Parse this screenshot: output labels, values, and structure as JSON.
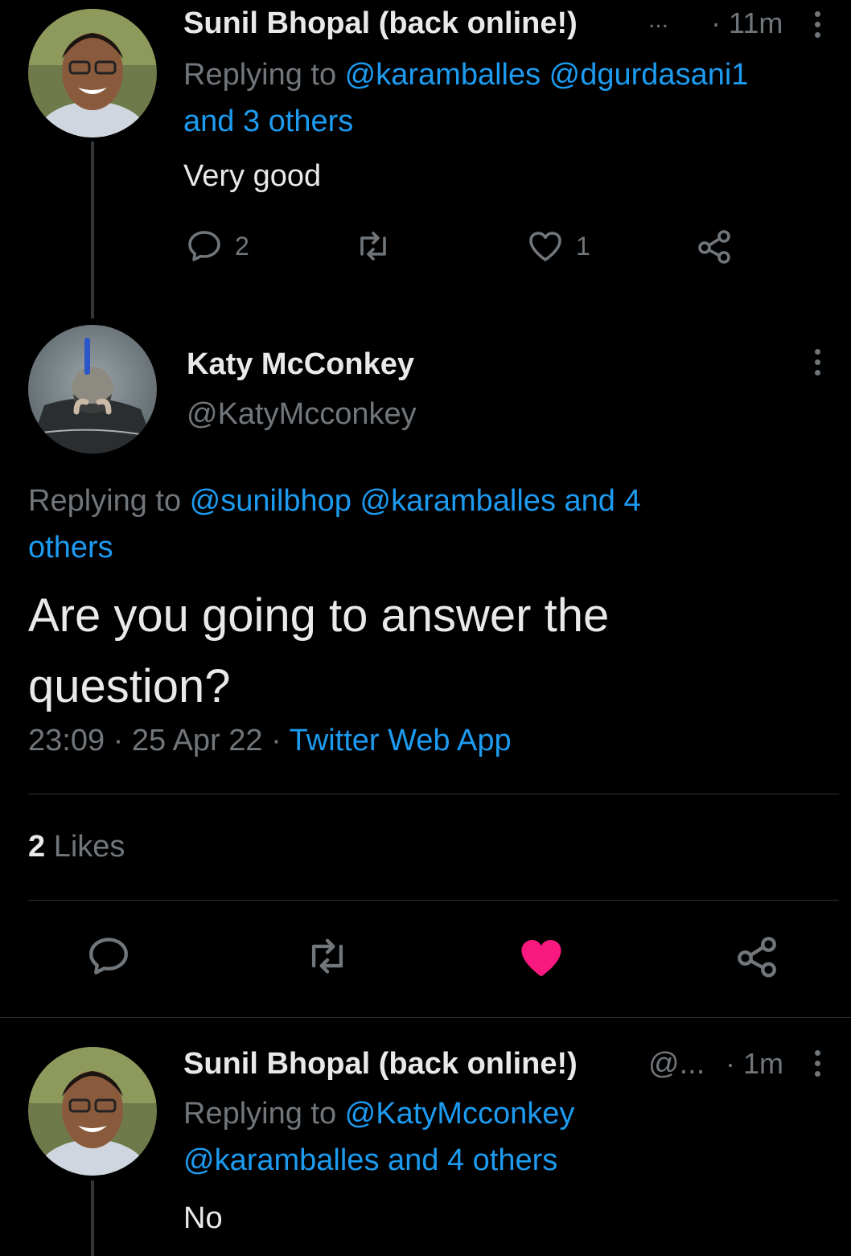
{
  "tweet1": {
    "name": "Sunil Bhopal (back online!)",
    "ellipsis": "...",
    "time": "· 11m",
    "reply_prefix": "Replying to ",
    "reply_h1": "@karamballes",
    "reply_h2": "@dgurdasani1",
    "reply_others": "and 3 others",
    "text": "Very good",
    "actions": {
      "reply_count": "2",
      "like_count": "1"
    }
  },
  "main": {
    "name": "Katy McConkey",
    "handle": "@KatyMcconkey",
    "reply_prefix": "Replying to ",
    "reply_h1": "@sunilbhop",
    "reply_h2": "@karamballes",
    "reply_others_a": "and 4",
    "reply_others_b": "others",
    "text": "Are you going to answer the question?",
    "meta_time": "23:09 · 25 Apr 22 · ",
    "meta_source": "Twitter Web App",
    "likes_count": "2",
    "likes_label": "Likes",
    "like_color": "#f91880"
  },
  "tweet3": {
    "name": "Sunil Bhopal (back online!)",
    "handle": "@...",
    "time": "· 1m",
    "reply_prefix": "Replying to ",
    "reply_h1": "@KatyMcconkey",
    "reply_h2": "@karamballes",
    "reply_others": "and 4 others",
    "text": "No"
  },
  "colors": {
    "accent": "#1d9bf0",
    "muted": "#71767b",
    "background": "#000000"
  },
  "icons": [
    "reply-icon",
    "retweet-icon",
    "like-icon",
    "share-icon",
    "more-icon"
  ]
}
